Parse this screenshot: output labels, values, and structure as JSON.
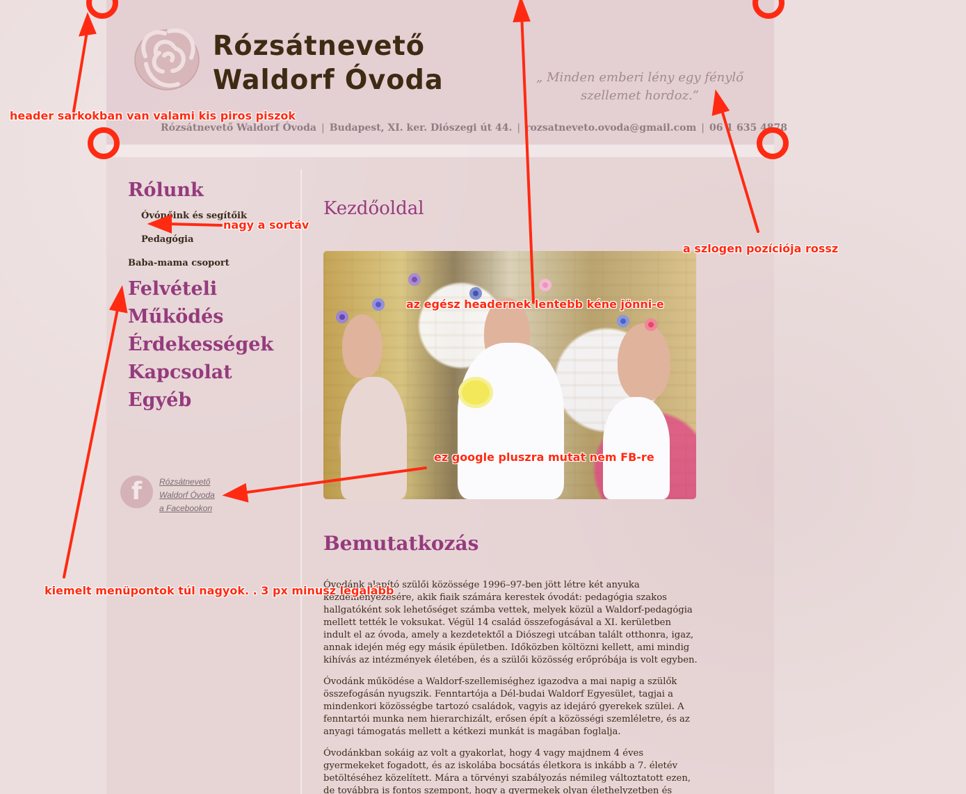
{
  "site": {
    "title_line1": "Rózsátnevető",
    "title_line2": "Waldorf Óvoda",
    "slogan": "„ Minden emberi lény egy fénylő szellemet hordoz.”",
    "contact": {
      "name": "Rózsátnevető Waldorf Óvoda",
      "address": "Budapest, XI. ker. Diószegi út 44.",
      "email": "rozsatneveto.ovoda@gmail.com",
      "phone": "06 1 635 4878",
      "separator": "|"
    }
  },
  "sidebar": {
    "nav": [
      {
        "label": "Rólunk"
      },
      {
        "label": "Óvónőink és segítőik"
      },
      {
        "label": "Pedagógia"
      },
      {
        "label": "Baba-mama csoport"
      },
      {
        "label": "Felvételi"
      },
      {
        "label": "Működés"
      },
      {
        "label": "Érdekességek"
      },
      {
        "label": "Kapcsolat"
      },
      {
        "label": "Egyéb"
      }
    ],
    "facebook": {
      "icon": "f",
      "line1": "Rózsátnevető",
      "line2": "Waldorf Óvoda",
      "line3": "a Facebookon"
    }
  },
  "main": {
    "page_title": "Kezdőoldal",
    "section_title": "Bemutatkozás",
    "paragraphs": [
      "Óvodánk alapító szülői közössége 1996–97-ben jött létre két anyuka kezdeményezésére, akik fiaik számára kerestek óvodát: pedagógia szakos hallgatóként sok lehetőséget számba vettek, melyek közül a Waldorf-pedagógia mellett tették le voksukat. Végül 14 család összefogásával a XI. kerületben indult el az óvoda, amely a kezdetektől a Diószegi utcában talált otthonra, igaz, annak idején még egy másik épületben. Időközben költözni kellett, ami mindig kihívás az intézmények életében, és a szülői közösség erőpróbája is volt egyben.",
      "Óvodánk működése a Waldorf-szellemiséghez igazodva a mai napig a szülők összefogásán nyugszik. Fenntartója a Dél-budai Waldorf Egyesület, tagjai a mindenkori közösségbe tartozó családok, vagyis az idejáró gyerekek szülei. A fenntartói munka nem hierarchizált, erősen épít a közösségi szemléletre, és az anyagi támogatás mellett a kétkezi munkát is magában foglalja.",
      "Óvodánkban sokáig az volt a gyakorlat, hogy 4 vagy majdnem 4 éves gyermekeket fogadott, és az iskolába bocsátás életkora is inkább a 7. életév betöltéséhez közelített. Mára a törvényi szabályozás némileg változtatott ezen, de továbbra is fontos szempont, hogy a gyermekek olyan élethelyzetben és közösségben legyenek, amit érettségük"
    ]
  },
  "annotations": {
    "header_corners": "header sarkokban van valami kis piros piszok",
    "line_spacing": "nagy a sortáv",
    "slogan_position": "a szlogen pozíciója rossz",
    "header_lower": "az egész headernek lentebb kéne jönni-e",
    "google_plus": "ez google pluszra mutat nem FB-re",
    "menu_size": "kiemelt menüpontok túl nagyok. . 3 px minusz legalább"
  },
  "colors": {
    "brand_purple": "#953b7d",
    "brown": "#3f2a13",
    "annotation_red": "#ff2a12"
  }
}
